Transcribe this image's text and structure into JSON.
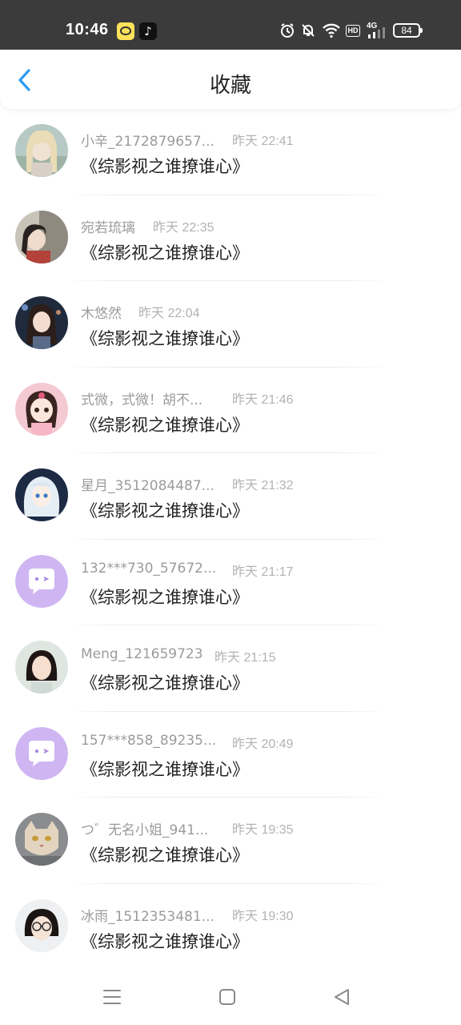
{
  "status_bar": {
    "time": "10:46",
    "battery": "84",
    "network": "4G",
    "hd": "HD",
    "icons": [
      "app-icon",
      "tiktok-icon",
      "alarm-icon",
      "mute-icon",
      "wifi-icon",
      "signal-icon",
      "battery-icon"
    ]
  },
  "header": {
    "title": "收藏",
    "back_icon": "chevron-left-icon",
    "accent": "#2b9cf2"
  },
  "items": [
    {
      "name": "小辛_2172879657...",
      "time": "昨天 22:41",
      "title": "《综影视之谁撩谁心》",
      "avatar": "photo"
    },
    {
      "name": "宛若琉璃",
      "time": "昨天 22:35",
      "title": "《综影视之谁撩谁心》",
      "avatar": "photo"
    },
    {
      "name": "木悠然",
      "time": "昨天 22:04",
      "title": "《综影视之谁撩谁心》",
      "avatar": "photo"
    },
    {
      "name": "式微，式微！胡不...",
      "time": "昨天 21:46",
      "title": "《综影视之谁撩谁心》",
      "avatar": "photo"
    },
    {
      "name": "星月_3512084487...",
      "time": "昨天 21:32",
      "title": "《综影视之谁撩谁心》",
      "avatar": "photo"
    },
    {
      "name": "132***730_57672...",
      "time": "昨天 21:17",
      "title": "《综影视之谁撩谁心》",
      "avatar": "default"
    },
    {
      "name": "Meng_121659723",
      "time": "昨天 21:15",
      "title": "《综影视之谁撩谁心》",
      "avatar": "photo"
    },
    {
      "name": "157***858_89235...",
      "time": "昨天 20:49",
      "title": "《综影视之谁撩谁心》",
      "avatar": "default"
    },
    {
      "name": "つ゛无名小姐_941...",
      "time": "昨天 19:35",
      "title": "《综影视之谁撩谁心》",
      "avatar": "photo"
    },
    {
      "name": "冰雨_1512353481...",
      "time": "昨天 19:30",
      "title": "《综影视之谁撩谁心》",
      "avatar": "photo"
    }
  ],
  "nav_bar": {
    "icons": [
      "menu-icon",
      "home-square-icon",
      "back-triangle-icon"
    ]
  }
}
